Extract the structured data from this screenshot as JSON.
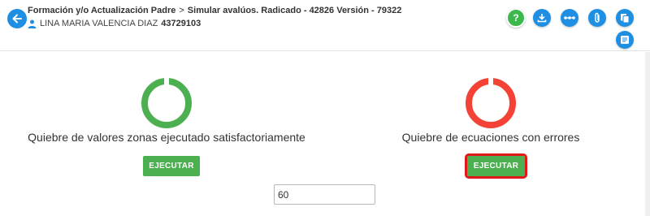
{
  "header": {
    "breadcrumb_parent": "Formación y/o Actualización Padre",
    "breadcrumb_separator": ">",
    "breadcrumb_current": "Simular avalúos. Radicado - 42826 Versión - 79322",
    "user_name": "LINA MARIA VALENCIA DIAZ",
    "user_id": "43729103"
  },
  "toolbar": {
    "icons": [
      "help-icon",
      "download-icon",
      "flow-icon",
      "attach-icon",
      "copy-icon",
      "list-icon"
    ]
  },
  "main": {
    "left": {
      "status": "success",
      "title": "Quiebre de valores zonas ejecutado satisfactoriamente",
      "button_label": "EJECUTAR"
    },
    "right": {
      "status": "error",
      "title": "Quiebre de ecuaciones con errores",
      "button_label": "EJECUTAR"
    },
    "value_input": "60"
  },
  "colors": {
    "primary": "#1e8fe3",
    "success": "#4caf50",
    "error": "#f44336",
    "focus_outline": "#e01818"
  }
}
